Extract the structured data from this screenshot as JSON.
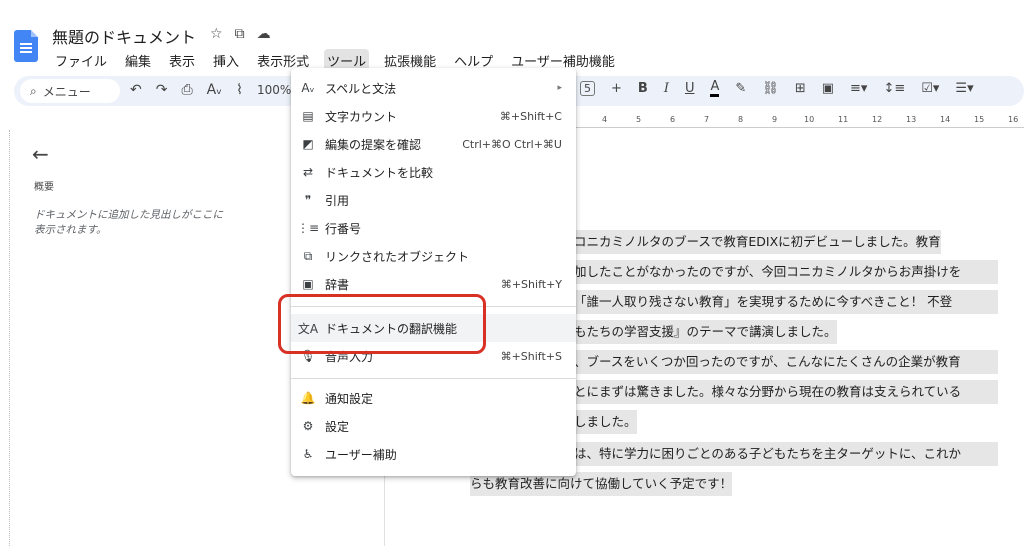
{
  "document": {
    "title": "無題のドキュメント",
    "title_icons": [
      "star-icon",
      "move-folder-icon",
      "cloud-status-icon"
    ]
  },
  "menubar": {
    "items": [
      "ファイル",
      "編集",
      "表示",
      "挿入",
      "表示形式",
      "ツール",
      "拡張機能",
      "ヘルプ",
      "ユーザー補助機能"
    ],
    "active_index": 5
  },
  "toolbar": {
    "search_label": "メニュー",
    "left_icons": [
      "undo-icon",
      "redo-icon",
      "print-icon",
      "spellcheck-icon",
      "paint-format-icon"
    ],
    "zoom": "100%",
    "font_size": "5",
    "plus": "+",
    "bold": "B",
    "italic": "I",
    "underline": "U",
    "text_color": "A"
  },
  "ruler": {
    "marks": [
      "4",
      "5",
      "6",
      "7",
      "8",
      "9",
      "10",
      "11",
      "12",
      "13",
      "14",
      "15",
      "16"
    ]
  },
  "outline": {
    "label": "概要",
    "hint_line1": "ドキュメントに追加した見出しがここに",
    "hint_line2": "表示されます。"
  },
  "body_text": {
    "line1": "コニカミノルタのブースで教育EDIXに初デビューしました。教育",
    "line2": "加したことがなかったのですが、今回コニカミノルタからお声掛けを",
    "line3": "「誰一人取り残さない教育」を実現するために今すべきこと！ 不登",
    "line4": "もたちの学習支援』のテーマで講演しました。",
    "line5": "、ブースをいくつか回ったのですが、こんなにたくさんの企業が教育",
    "line6": "とにまずは驚きました。様々な分野から現在の教育は支えられている",
    "line7": "しました。",
    "line8": "は、特に学力に困りごとのある子どもたちを主ターゲットに、これか",
    "line9": "らも教育改善に向けて協働していく予定です！"
  },
  "tools_menu": {
    "items": [
      {
        "label": "スペルと文法",
        "icon": "spellcheck-icon",
        "shortcut": "▸"
      },
      {
        "label": "文字カウント",
        "icon": "word-count-icon",
        "shortcut": "⌘+Shift+C"
      },
      {
        "label": "編集の提案を確認",
        "icon": "review-edits-icon",
        "shortcut": "Ctrl+⌘O Ctrl+⌘U"
      },
      {
        "label": "ドキュメントを比較",
        "icon": "compare-icon",
        "shortcut": ""
      },
      {
        "label": "引用",
        "icon": "quote-icon",
        "shortcut": ""
      },
      {
        "label": "行番号",
        "icon": "line-numbers-icon",
        "shortcut": ""
      },
      {
        "label": "リンクされたオブジェクト",
        "icon": "linked-objects-icon",
        "shortcut": ""
      },
      {
        "label": "辞書",
        "icon": "dictionary-icon",
        "shortcut": "⌘+Shift+Y"
      },
      {
        "label": "ドキュメントの翻訳機能",
        "icon": "translate-icon",
        "shortcut": ""
      },
      {
        "label": "音声入力",
        "icon": "microphone-icon",
        "shortcut": "⌘+Shift+S"
      },
      {
        "label": "通知設定",
        "icon": "bell-icon",
        "shortcut": ""
      },
      {
        "label": "設定",
        "icon": "preferences-icon",
        "shortcut": ""
      },
      {
        "label": "ユーザー補助",
        "icon": "accessibility-icon",
        "shortcut": ""
      }
    ],
    "highlighted_index": 8
  },
  "colors": {
    "doc_blue": "#4285f4",
    "toolbar_bg": "#edf2fa",
    "highlight_red": "#d93025",
    "text_selection": "#e6e6e6"
  }
}
